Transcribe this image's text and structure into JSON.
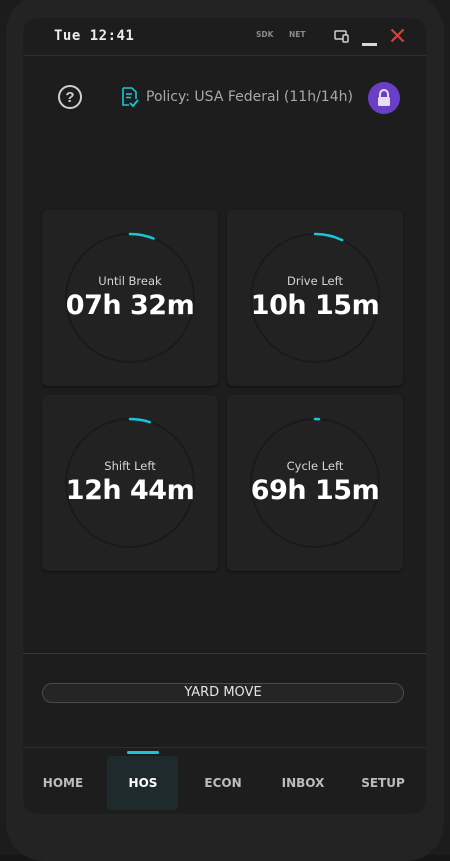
{
  "status_bar": {
    "clock": "Tue 12:41",
    "tags": [
      "SDK",
      "NET"
    ],
    "icons": [
      "devices-icon",
      "minimize-icon",
      "close-icon"
    ],
    "close_color": "#e53935"
  },
  "header": {
    "help_icon": "help-circle-icon",
    "policy_icon": "document-check-icon",
    "policy_text": "Policy: USA Federal (11h/14h)",
    "lock_icon": "lock-icon",
    "lock_color": "#6a3fc7"
  },
  "accent_color": "#19c6d8",
  "timers": [
    {
      "label": "Until Break",
      "value": "07h 32m",
      "progress": 0.06
    },
    {
      "label": "Drive Left",
      "value": "10h 15m",
      "progress": 0.07
    },
    {
      "label": "Shift Left",
      "value": "12h 44m",
      "progress": 0.05
    },
    {
      "label": "Cycle Left",
      "value": "69h 15m",
      "progress": 0.01
    }
  ],
  "yard_move": {
    "label": "YARD MOVE"
  },
  "nav": {
    "items": [
      "HOME",
      "HOS",
      "ECON",
      "INBOX",
      "SETUP"
    ],
    "active": "HOS"
  }
}
